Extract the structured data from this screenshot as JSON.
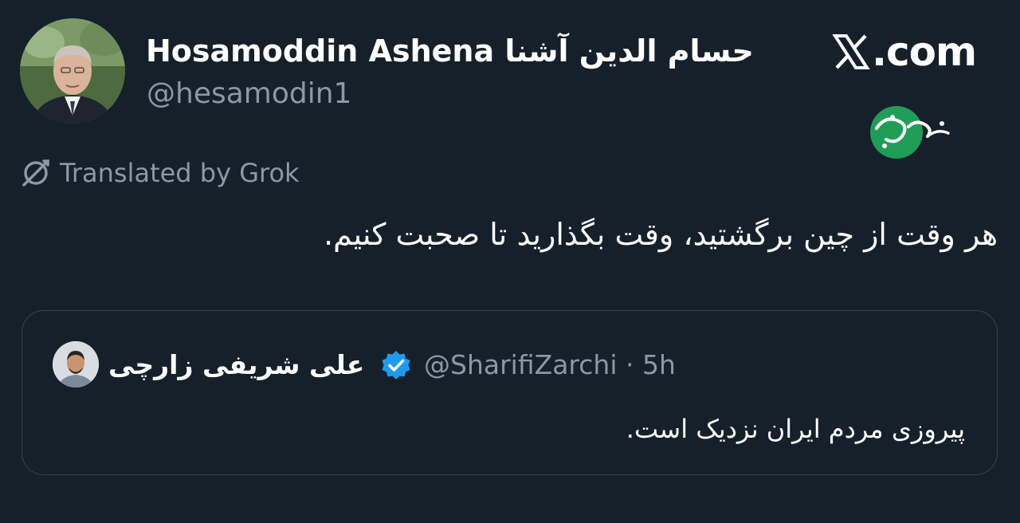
{
  "author": {
    "display_name": "Hosamoddin Ashena حسام الدین آشنا",
    "handle": "@hesamodin1"
  },
  "brand": {
    "x_icon": "x-logo-icon",
    "domain_text": ".com"
  },
  "watermark": {
    "logo": "khabarfori-logo",
    "text": "خبر فوری",
    "color": "#1f9d57"
  },
  "translation": {
    "icon": "grok-icon",
    "label": "Translated by Grok"
  },
  "tweet": {
    "text": "هر وقت از چین برگشتید، وقت بگذارید تا صحبت کنیم."
  },
  "quoted": {
    "name": "علی شریفی زارچی",
    "verified_icon": "verified-badge-icon",
    "handle_time": "@SharifiZarchi · 5h",
    "text": "پیروزی مردم ایران نزدیک است."
  },
  "colors": {
    "background": "#15202b",
    "secondary_text": "#8b98a5",
    "border": "#38444d",
    "verified": "#1d9bf0"
  }
}
